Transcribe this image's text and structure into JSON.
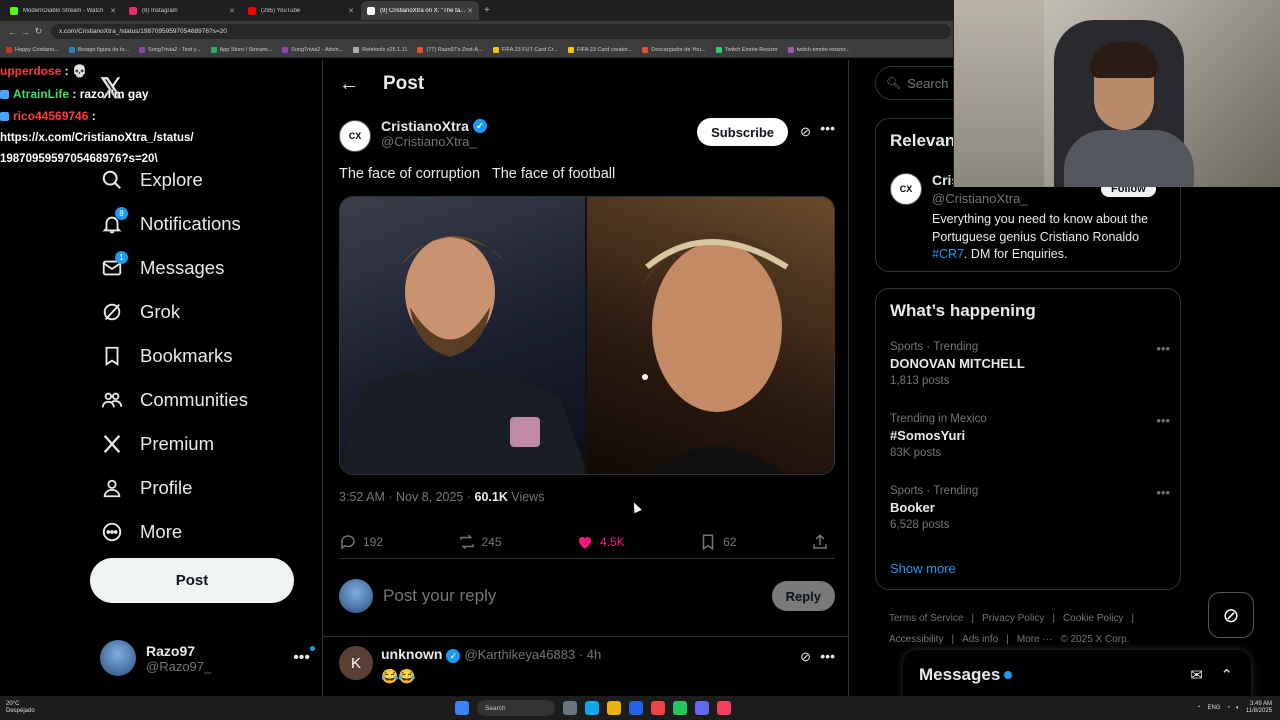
{
  "browser": {
    "tabs": [
      {
        "title": "ModernDiablo Stream - Watch",
        "color": "#53fc18",
        "active": false
      },
      {
        "title": "(8) Instagram",
        "color": "#e1306c",
        "active": false
      },
      {
        "title": "(295) YouTube",
        "color": "#ff0000",
        "active": false
      },
      {
        "title": "(9) CristianoXtra on X: \"The fa...",
        "color": "#ffffff",
        "active": true
      }
    ],
    "url": "x.com/CristianoXtra_/status/1987095959705468976?s=20",
    "bookmarks": [
      "Happy Cristiano...",
      "Burago figura de to...",
      "SongTrivia2 - Test y...",
      "App Store / Streami...",
      "SongTrivia2 - Advin...",
      "Reletools v25.1.11",
      "(77) Razo97's Zest-A...",
      "FIFA 23 FUT Card Cr...",
      "FIFA 23 Card creator...",
      "Descargador de You...",
      "Twitch Emote Resizer",
      "twitch emote resizer..."
    ]
  },
  "chat": {
    "lines": [
      {
        "user": "upperdose",
        "sep": " : ",
        "msg": "💀",
        "color": "red"
      },
      {
        "user": "AtrainLife",
        "sep": " : ",
        "msg": "razo I'm gay",
        "color": "green"
      },
      {
        "user": "rico44569746",
        "sep": " :",
        "msg": "",
        "color": "red"
      }
    ],
    "url_line_1": "https://x.com/CristianoXtra_/status/",
    "url_line_2": "1987095959705468976?s=20\\"
  },
  "nav": {
    "items": [
      {
        "label": "Explore",
        "icon": "search-icon"
      },
      {
        "label": "Notifications",
        "icon": "bell-icon",
        "badge": "8"
      },
      {
        "label": "Messages",
        "icon": "mail-icon",
        "badge": "1"
      },
      {
        "label": "Grok",
        "icon": "grok-icon"
      },
      {
        "label": "Bookmarks",
        "icon": "bookmark-icon"
      },
      {
        "label": "Communities",
        "icon": "communities-icon"
      },
      {
        "label": "Premium",
        "icon": "x-icon"
      },
      {
        "label": "Profile",
        "icon": "person-icon"
      },
      {
        "label": "More",
        "icon": "more-circle-icon"
      }
    ],
    "post_label": "Post",
    "account": {
      "name": "Razo97",
      "handle": "@Razo97_"
    }
  },
  "post": {
    "header_title": "Post",
    "author_name": "CristianoXtra",
    "author_handle": "@CristianoXtra_",
    "subscribe_label": "Subscribe",
    "text": "The face of corruption   The face of football",
    "time": "3:52 AM · Nov 8, 2025 · ",
    "views_count": "60.1K",
    "views_label": " Views",
    "replies": "192",
    "reposts": "245",
    "likes": "4.5K",
    "bookmarks": "62",
    "reply_placeholder": "Post your reply",
    "reply_button": "Reply"
  },
  "comment": {
    "avatar_letter": "K",
    "name": "unknown",
    "handle": "@Karthikeya46883",
    "time": " · 4h",
    "text": "😂😂"
  },
  "right": {
    "search_placeholder": "Search",
    "relevant_title": "Relevant people",
    "relevant_name": "CristianoXtra",
    "relevant_handle": "@CristianoXtra_",
    "follow_label": "Follow",
    "bio_text": "Everything you need to know about the Portuguese genius Cristiano Ronaldo ",
    "bio_tag": "#CR7",
    "bio_end": ". DM for Enquiries.",
    "happening_title": "What’s happening",
    "trends": [
      {
        "category": "Sports · Trending",
        "name": "DONOVAN MITCHELL",
        "count": "1,813 posts"
      },
      {
        "category": "Trending in Mexico",
        "name": "#SomosYuri",
        "count": "83K posts"
      },
      {
        "category": "Sports · Trending",
        "name": "Booker",
        "count": "6,528 posts"
      }
    ],
    "show_more": "Show more",
    "footer_links": [
      "Terms of Service",
      "|",
      "Privacy Policy",
      "|",
      "Cookie Policy",
      "|"
    ],
    "footer_links_2": [
      "Accessibility",
      "|",
      "Ads info",
      "|",
      "More ···",
      "© 2025 X Corp."
    ],
    "messages_title": "Messages"
  },
  "taskbar": {
    "weather_temp": "20°C",
    "weather_desc": "Despejado",
    "search_label": "Search",
    "lang": "ENG",
    "time": "3:49 AM",
    "date": "11/8/2025"
  },
  "colors": {
    "accent": "#1d9bf0",
    "like": "#f91880",
    "background": "#000000"
  }
}
